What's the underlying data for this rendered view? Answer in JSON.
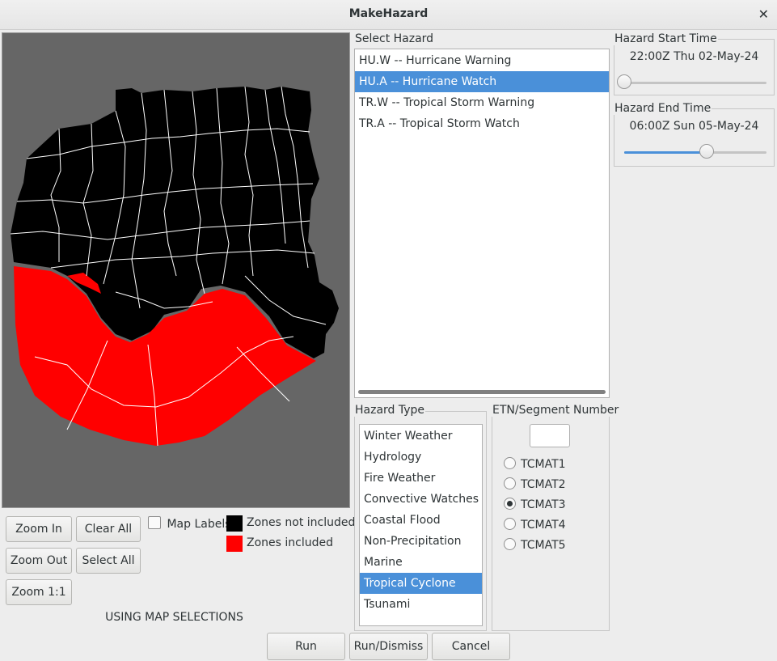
{
  "window": {
    "title": "MakeHazard"
  },
  "map": {
    "zoom_in": "Zoom In",
    "zoom_out": "Zoom Out",
    "zoom_1to1": "Zoom 1:1",
    "clear_all": "Clear All",
    "select_all": "Select All",
    "map_labels": "Map Labels",
    "map_labels_checked": false,
    "legend_not_included": "Zones not included",
    "legend_included": "Zones included",
    "color_not_included": "#000000",
    "color_included": "#ff0000",
    "status": "USING MAP SELECTIONS"
  },
  "select_hazard": {
    "label": "Select Hazard",
    "items": [
      "HU.W -- Hurricane Warning",
      "HU.A -- Hurricane Watch",
      "TR.W -- Tropical Storm Warning",
      "TR.A -- Tropical Storm Watch"
    ],
    "selected_index": 1
  },
  "hazard_start": {
    "label": "Hazard Start Time",
    "time": "22:00Z Thu 02-May-24",
    "slider_fraction": 0.0
  },
  "hazard_end": {
    "label": "Hazard End Time",
    "time": "06:00Z Sun 05-May-24",
    "slider_fraction": 0.58
  },
  "hazard_type": {
    "label": "Hazard Type",
    "items": [
      "Winter Weather",
      "Hydrology",
      "Fire Weather",
      "Convective Watches",
      "Coastal Flood",
      "Non-Precipitation",
      "Marine",
      "Tropical Cyclone",
      "Tsunami"
    ],
    "selected_index": 7
  },
  "etn": {
    "label": "ETN/Segment Number",
    "value": "",
    "options": [
      "TCMAT1",
      "TCMAT2",
      "TCMAT3",
      "TCMAT4",
      "TCMAT5"
    ],
    "selected_index": 2
  },
  "actions": {
    "run": "Run",
    "run_dismiss": "Run/Dismiss",
    "cancel": "Cancel"
  },
  "colors": {
    "accent": "#4a90d9",
    "map_background": "#666666"
  }
}
